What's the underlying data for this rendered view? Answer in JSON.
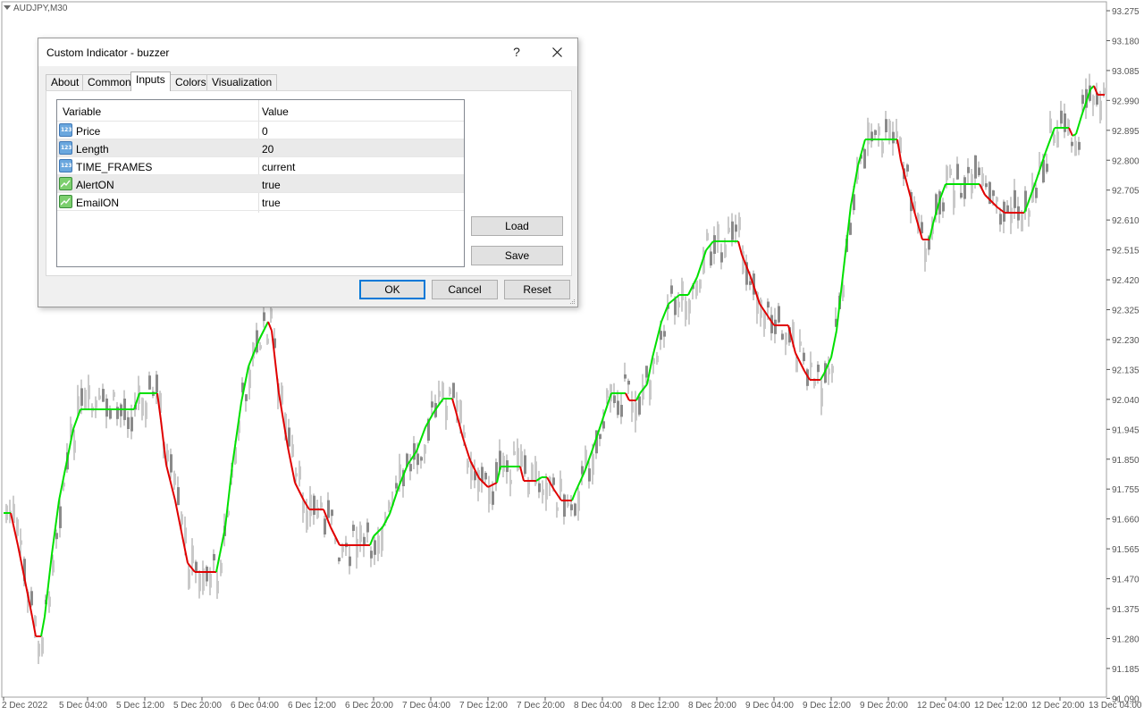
{
  "chart": {
    "symbol": "AUDJPY,M30",
    "price_axis": [
      "93.275",
      "93.180",
      "93.085",
      "92.990",
      "92.895",
      "92.800",
      "92.705",
      "92.610",
      "92.515",
      "92.420",
      "92.325",
      "92.230",
      "92.135",
      "92.040",
      "91.945",
      "91.850",
      "91.755",
      "91.660",
      "91.565",
      "91.470",
      "91.375",
      "91.280",
      "91.185",
      "91.090"
    ],
    "time_axis": [
      "2 Dec 2022",
      "5 Dec 04:00",
      "5 Dec 12:00",
      "5 Dec 20:00",
      "6 Dec 04:00",
      "6 Dec 12:00",
      "6 Dec 20:00",
      "7 Dec 04:00",
      "7 Dec 12:00",
      "7 Dec 20:00",
      "8 Dec 04:00",
      "8 Dec 12:00",
      "8 Dec 20:00",
      "9 Dec 04:00",
      "9 Dec 12:00",
      "9 Dec 20:00",
      "12 Dec 04:00",
      "12 Dec 12:00",
      "12 Dec 20:00",
      "13 Dec 04:00"
    ],
    "colors": {
      "up": "#00e000",
      "down": "#e00000",
      "candle": "#808080",
      "axis": "#555555"
    }
  },
  "dialog": {
    "title": "Custom Indicator - buzzer",
    "help": "?",
    "close": "✕",
    "tabs": [
      {
        "label": "About"
      },
      {
        "label": "Common"
      },
      {
        "label": "Inputs",
        "active": true
      },
      {
        "label": "Colors"
      },
      {
        "label": "Visualization"
      }
    ],
    "grid": {
      "col_variable": "Variable",
      "col_value": "Value",
      "rows": [
        {
          "variable": "Price",
          "value": "0",
          "icon": "number-icon"
        },
        {
          "variable": "Length",
          "value": "20",
          "icon": "number-icon"
        },
        {
          "variable": "TIME_FRAMES",
          "value": "current",
          "icon": "number-icon"
        },
        {
          "variable": "AlertON",
          "value": "true",
          "icon": "bool-icon"
        },
        {
          "variable": "EmailON",
          "value": "true",
          "icon": "bool-icon"
        }
      ],
      "number_icon_text": "123"
    },
    "buttons": {
      "load": "Load",
      "save": "Save",
      "ok": "OK",
      "cancel": "Cancel",
      "reset": "Reset"
    }
  }
}
